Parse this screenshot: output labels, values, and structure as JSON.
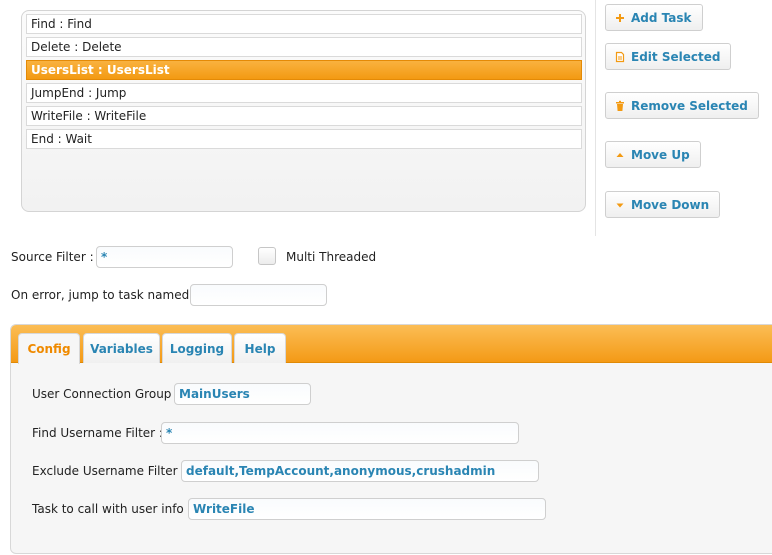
{
  "tasks": [
    {
      "label": "Find : Find"
    },
    {
      "label": "Delete : Delete"
    },
    {
      "label": "UsersList : UsersList"
    },
    {
      "label": "JumpEnd : Jump"
    },
    {
      "label": "WriteFile : WriteFile"
    },
    {
      "label": "End : Wait"
    }
  ],
  "selected_task": "UsersList : UsersList",
  "buttons": {
    "add_task": "Add Task",
    "edit_selected": "Edit Selected",
    "remove_selected": "Remove Selected",
    "move_up": "Move Up",
    "move_down": "Move Down"
  },
  "form": {
    "source_filter_label": "Source Filter :",
    "source_filter_value": "*",
    "multi_threaded_label": "Multi Threaded",
    "multi_threaded_checked": false,
    "on_error_label": "On error, jump to task named :",
    "on_error_value": ""
  },
  "tabs": [
    {
      "label": "Config",
      "active": true
    },
    {
      "label": "Variables",
      "active": false
    },
    {
      "label": "Logging",
      "active": false
    },
    {
      "label": "Help",
      "active": false
    }
  ],
  "config": {
    "user_connection_group_label": "User Connection Group :",
    "user_connection_group_value": "MainUsers",
    "find_username_filter_label": "Find Username Filter :",
    "find_username_filter_value": "*",
    "exclude_username_filter_label": "Exclude Username Filter :",
    "exclude_username_filter_value": "default,TempAccount,anonymous,crushadmin",
    "task_to_call_label": "Task to call with user info :",
    "task_to_call_value": "WriteFile"
  },
  "colors": {
    "accent_orange": "#f39a12",
    "link_blue": "#2a85b3"
  },
  "icons": {
    "add_task": "plus-icon",
    "edit_selected": "document-icon",
    "remove_selected": "trash-icon",
    "move_up": "triangle-up-icon",
    "move_down": "triangle-down-icon"
  }
}
